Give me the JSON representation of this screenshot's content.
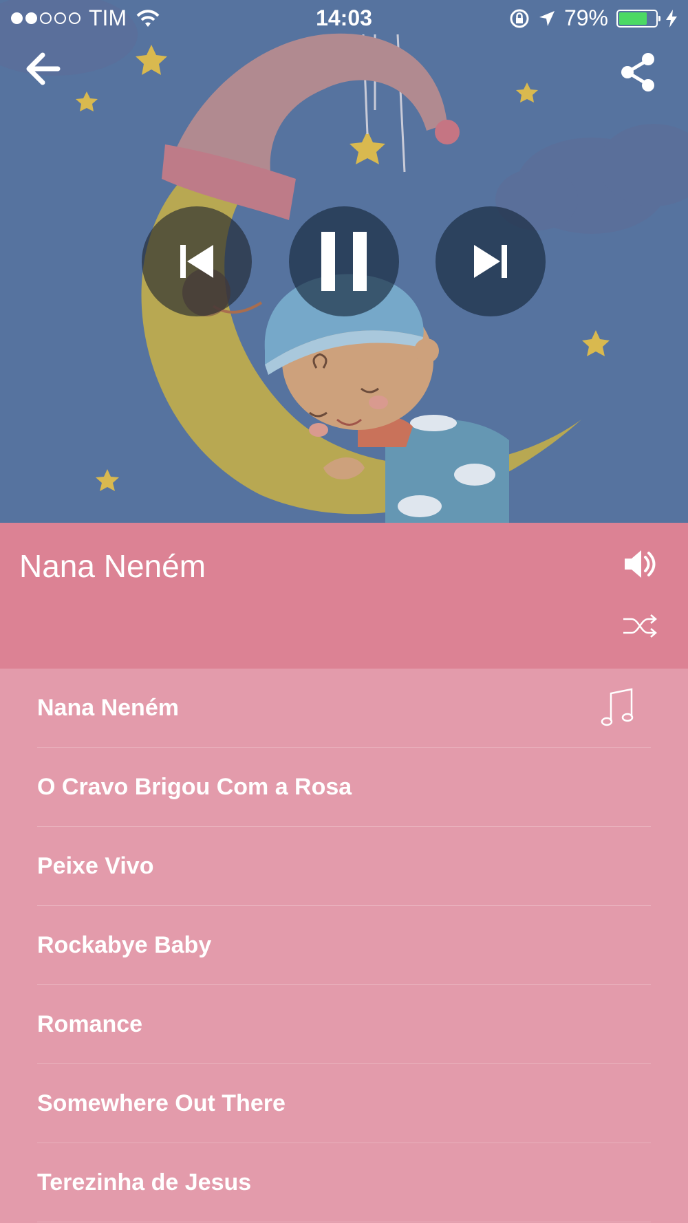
{
  "status_bar": {
    "carrier": "TIM",
    "time": "14:03",
    "battery_percent": "79%",
    "battery_level": 0.79,
    "signal_bars_filled": 2,
    "signal_bars_total": 5
  },
  "header": {
    "back_icon": "arrow-left-icon",
    "share_icon": "share-icon"
  },
  "player": {
    "controls": {
      "previous_icon": "skip-previous-icon",
      "pause_icon": "pause-icon",
      "next_icon": "skip-next-icon"
    }
  },
  "now_playing": {
    "title": "Nana Neném",
    "volume_icon": "speaker-icon",
    "shuffle_icon": "shuffle-icon"
  },
  "playlist": {
    "tracks": [
      {
        "name": "Nana Neném",
        "playing": true
      },
      {
        "name": "O Cravo Brigou Com a Rosa",
        "playing": false
      },
      {
        "name": "Peixe Vivo",
        "playing": false
      },
      {
        "name": "Rockabye Baby",
        "playing": false
      },
      {
        "name": "Romance",
        "playing": false
      },
      {
        "name": "Somewhere Out There",
        "playing": false
      },
      {
        "name": "Terezinha de Jesus",
        "playing": false
      }
    ]
  },
  "colors": {
    "artwork_bg": "#56739f",
    "now_playing_bar": "#dc8294",
    "playlist_bg": "#e39bab",
    "battery_fill": "#4cd964"
  }
}
